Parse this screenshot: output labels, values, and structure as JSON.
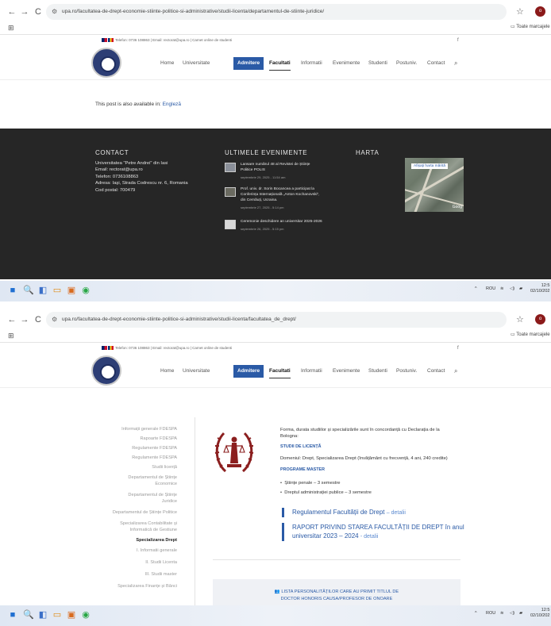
{
  "browser": {
    "back": "←",
    "forward": "→",
    "reload": "C",
    "tune": "⚙",
    "star": "☆",
    "profile": "o",
    "apps": "⊞",
    "bookmarks_label": "Toate marcajele"
  },
  "shot1": {
    "url": "upa.ro/facultatea-de-drept-economie-stiinte-politice-si-administrative/studii-licenta/departamentul-de-stiinte-juridice/"
  },
  "shot2": {
    "url": "upa.ro/facultatea-de-drept-economie-stiinte-politice-si-administrative/studii-licenta/facultatea_de_drept/"
  },
  "site": {
    "topbar_text": "Telefon: 0736 108863 | Email: rectorat@upa.ro | Carnet online de studenti",
    "facebook": "f",
    "menu": [
      "Home",
      "Universitate",
      "Admitere",
      "Facultati",
      "Informatii",
      "Evenimente",
      "Studenti",
      "Postuniv.",
      "Contact"
    ],
    "search_icon": "⌕"
  },
  "page1": {
    "post_notice_prefix": "This post is also available in:",
    "post_notice_link": "Engleză"
  },
  "footer": {
    "contact_title": "CONTACT",
    "contact_lines": [
      "Universitatea \"Petre Andrei\" din Iasi",
      "Email: rectorat@upa.ro",
      "Telefon: 0736108863",
      "Adresa: Iaşi, Strada Codrescu nr. 6, Romania",
      "Cod postal: 700479"
    ],
    "events_title": "ULTIMELE EVENIMENTE",
    "events": [
      {
        "title_lines": [
          "Lansare numărul 48 al Revistei de Științe",
          "Politice POLIS"
        ],
        "date": "septembrie 29, 2025 - 11:54 am"
      },
      {
        "title_lines": [
          "Prof. univ. dr. Sorin Bocancea a participat la",
          "Conferința Internațională „Anton Kochanovski”,",
          "din Cernăuți, Ucraina."
        ],
        "date": "septembrie 27, 2025 - 5:14 pm"
      },
      {
        "title_lines": [
          "Ceremonie deschidere an universitar 2025-2026"
        ],
        "date": "septembrie 26, 2025 - 5:15 pm"
      }
    ],
    "map_title": "HARTA",
    "map_link": "Afișați harta mărită",
    "map_brand": "Goog"
  },
  "taskbar": {
    "icons": [
      "■",
      "🔍",
      "◧",
      "▭",
      "▣",
      "◉"
    ],
    "tray_arrow": "^",
    "language": "ROU",
    "wifi": "≋",
    "volume": "◁)",
    "battery": "▰",
    "time1": "12:5",
    "date1": "02/10/202",
    "time2": "12:5",
    "date2": "02/10/202"
  },
  "page2": {
    "sidebar": [
      "Informații generale FDESPA",
      "Rapoarte FDESPA",
      "Regulamente FDESPA",
      "Regulamente FDESPA",
      "Studii licență",
      "Departamentul de Științe",
      "Economice",
      "Departamentul de Științe",
      "Juridice",
      "Departamentul de Științe Politice",
      "Specializarea Contabilitate și",
      "Informatică de Gestiune",
      "Specializarea Drept",
      "I. Informatii generale",
      "II. Studii Licenta",
      "III. Studii master",
      "Specializarea Finanțe și Bănci"
    ],
    "intro_lines": [
      "Forma, durata studiilor și specializările sunt în concordanță cu Declarația de la",
      "Bologna:"
    ],
    "licenta_heading": "STUDII DE LICENȚĂ",
    "licenta_text": "Domeniul: Drept, Specializarea Drept (învățământ cu frecvență, 4 ani, 240 credite)",
    "master_heading": "PROGRAME MASTER",
    "master_items": [
      "Științe penale – 3 semestre",
      "Dreptul administrației publice – 3 semestre"
    ],
    "link1_title": "Regulamentul Facultății de Drept",
    "link1_sub": "– detalii",
    "link2_title_lines": [
      "RAPORT PRIVIND STAREA FACULTĂȚII DE DREPT în anul",
      "universitar 2023 – 2024"
    ],
    "link2_sub": "- detalii",
    "honoris_lines": [
      "LISTA PERSONALITĂȚILOR CARE AU PRIMIT TITLUL DE",
      "DOCTOR HONORIS CAUSA/PROFESOR DE ONOARE"
    ]
  }
}
